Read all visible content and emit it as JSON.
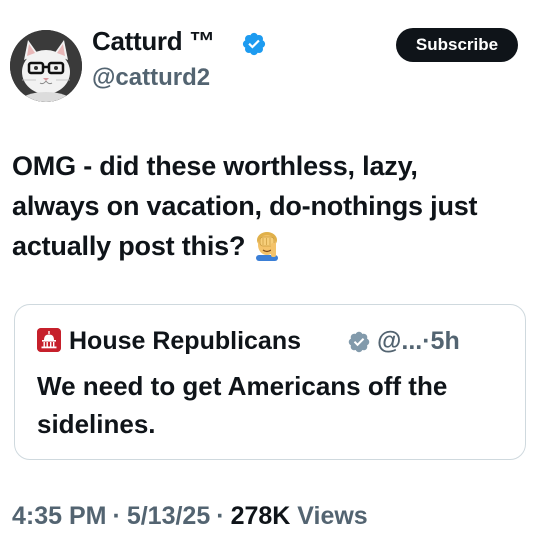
{
  "author": {
    "display_name": "Catturd ™",
    "handle": "@catturd2",
    "verified": true,
    "avatar_icon": "cat-with-glasses-avatar"
  },
  "actions": {
    "subscribe_label": "Subscribe"
  },
  "tweet": {
    "text": "OMG - did these worthless, lazy, always on vacation, do-nothings just actually post this?",
    "emoji_icon": "face-palm-emoji"
  },
  "quote": {
    "display_name": "House Republicans",
    "handle": "@...",
    "separator": "·",
    "time_ago": "5h",
    "text": "We need to get Americans off the sidelines.",
    "badge_icon": "gray-verified-badge-icon",
    "avatar_icon": "capitol-icon"
  },
  "meta": {
    "time": "4:35 PM",
    "date": "5/13/25",
    "views_count": "278K",
    "views_label": "Views",
    "separator": "·"
  },
  "colors": {
    "text_primary": "#0f1419",
    "text_secondary": "#536471",
    "verified_blue": "#1d9bf0",
    "border": "#cfd9de",
    "subscribe_bg": "#0f1419",
    "republican_red": "#c6202b"
  }
}
